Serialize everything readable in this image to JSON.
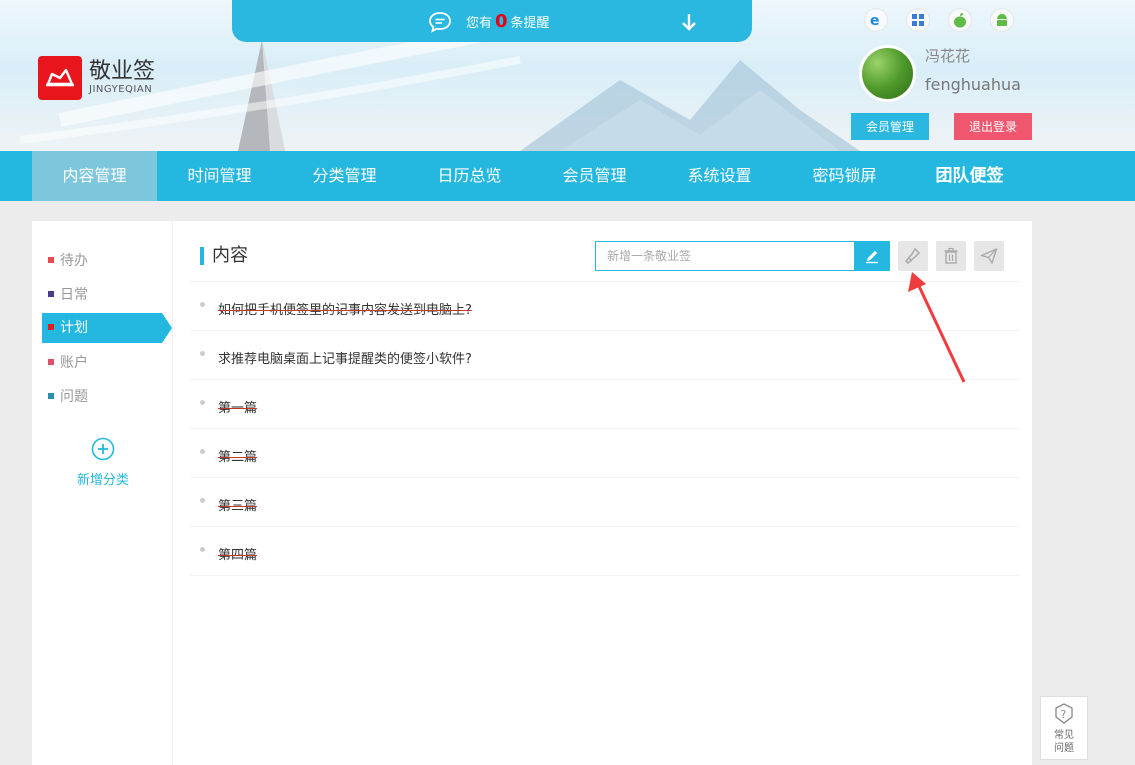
{
  "brand": {
    "name_cn": "敬业签",
    "name_en": "JINGYEQIAN"
  },
  "notice": {
    "prefix": "您有",
    "count": "0",
    "suffix": "条提醒"
  },
  "platforms": [
    "ie-icon",
    "windows-icon",
    "apple-icon",
    "android-icon"
  ],
  "user": {
    "display_name": "冯花花",
    "username": "fenghuahua"
  },
  "header_buttons": {
    "member": "会员管理",
    "logout": "退出登录"
  },
  "nav": [
    "内容管理",
    "时间管理",
    "分类管理",
    "日历总览",
    "会员管理",
    "系统设置",
    "密码锁屏",
    "团队便签"
  ],
  "sidebar": {
    "categories": [
      {
        "label": "待办",
        "color": "#e84a4a"
      },
      {
        "label": "日常",
        "color": "#4a3a8c"
      },
      {
        "label": "计划",
        "color": "#e02020"
      },
      {
        "label": "账户",
        "color": "#e0506a"
      },
      {
        "label": "问题",
        "color": "#2a8fb0"
      }
    ],
    "add_label": "新增分类"
  },
  "content": {
    "title": "内容",
    "input_placeholder": "新增一条敬业签",
    "notes": [
      {
        "text": "如何把手机便签里的记事内容发送到电脑上?",
        "done": true
      },
      {
        "text": "求推荐电脑桌面上记事提醒类的便签小软件?",
        "done": false
      },
      {
        "text": "第一篇",
        "done": true
      },
      {
        "text": "第二篇",
        "done": true
      },
      {
        "text": "第三篇",
        "done": true
      },
      {
        "text": "第四篇",
        "done": true
      }
    ]
  },
  "help": {
    "line1": "常见",
    "line2": "问题"
  },
  "colors": {
    "accent": "#24b7df",
    "logout": "#f0566e",
    "brand_red": "#e8161c"
  }
}
